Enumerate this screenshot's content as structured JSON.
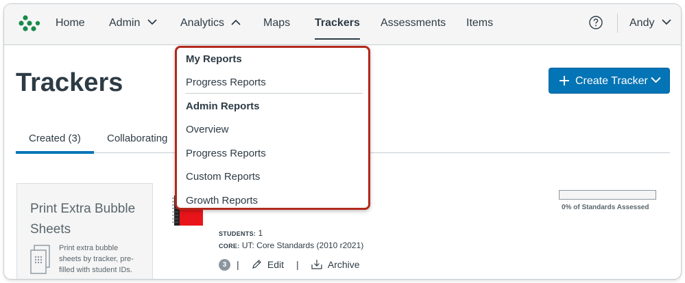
{
  "nav": {
    "items": [
      {
        "label": "Home"
      },
      {
        "label": "Admin"
      },
      {
        "label": "Analytics"
      },
      {
        "label": "Maps"
      },
      {
        "label": "Trackers"
      },
      {
        "label": "Assessments"
      },
      {
        "label": "Items"
      }
    ],
    "user": "Andy",
    "help_icon": "help-circle-icon"
  },
  "analytics_menu": {
    "my_reports_heading": "My Reports",
    "my_reports": [
      "Progress Reports"
    ],
    "admin_reports_heading": "Admin Reports",
    "admin_reports": [
      "Overview",
      "Progress Reports",
      "Custom Reports",
      "Growth Reports"
    ]
  },
  "page": {
    "title": "Trackers",
    "create_button": "Create Tracker"
  },
  "tabs": {
    "created": "Created (3)",
    "collaborating": "Collaborating"
  },
  "print_card": {
    "title": "Print Extra Bubble Sheets",
    "description": "Print extra bubble sheets by tracker, pre-filled with student IDs."
  },
  "tracker": {
    "students_label": "STUDENTS:",
    "students_value": "1",
    "core_label": "CORE:",
    "core_value": "UT: Core Standards (2010 r2021)",
    "progress_label": "0% of Standards Assessed",
    "progress_fraction": 0,
    "count": "3",
    "edit": "Edit",
    "archive": "Archive",
    "separator": "|"
  },
  "colors": {
    "brand_green": "#1a8a4b",
    "primary_blue": "#0374b5",
    "highlight_red": "#b2281b",
    "thumb_red": "#e8141a"
  }
}
